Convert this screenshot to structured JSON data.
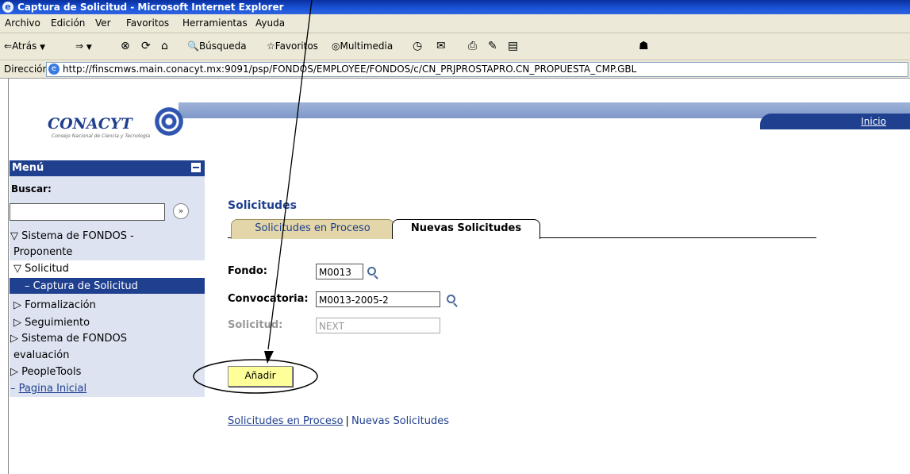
{
  "window": {
    "title": "Captura de Solicitud - Microsoft Internet Explorer"
  },
  "menubar": {
    "items": [
      "Archivo",
      "Edición",
      "Ver",
      "Favoritos",
      "Herramientas",
      "Ayuda"
    ]
  },
  "toolbar": {
    "back_label": "Atrás",
    "search_label": "Búsqueda",
    "favorites_label": "Favoritos",
    "multimedia_label": "Multimedia"
  },
  "address": {
    "label": "Dirección",
    "url": "http://finscmws.main.conacyt.mx:9091/psp/FONDOS/EMPLOYEE/FONDOS/c/CN_PRJPROSTAPRO.CN_PROPUESTA_CMP.GBL"
  },
  "header": {
    "logo_text": "CONACYT",
    "logo_tagline": "Consejo Nacional de Ciencia y Tecnología",
    "home_link": "Inicio"
  },
  "sidebar": {
    "menu_title": "Menú",
    "search_label": "Buscar:",
    "search_value": "",
    "items": [
      {
        "label": "Sistema de FONDOS -",
        "marker": "▽"
      },
      {
        "label": "Proponente",
        "marker": ""
      },
      {
        "label": "Solicitud",
        "marker": "▽"
      },
      {
        "label": "Captura de Solicitud",
        "marker": "–"
      },
      {
        "label": "Formalización",
        "marker": "▷"
      },
      {
        "label": "Seguimiento",
        "marker": "▷"
      },
      {
        "label": "Sistema de FONDOS",
        "marker": "▷"
      },
      {
        "label": "evaluación",
        "marker": ""
      },
      {
        "label": "PeopleTools",
        "marker": "▷"
      },
      {
        "label": "Pagina Inicial",
        "marker": "–"
      }
    ]
  },
  "main": {
    "title": "Solicitudes",
    "tabs": [
      {
        "label": "Solicitudes en Proceso"
      },
      {
        "label": "Nuevas Solicitudes"
      }
    ],
    "fields": {
      "fondo_label": "Fondo:",
      "fondo_value": "M0013",
      "convocatoria_label": "Convocatoria:",
      "convocatoria_value": "M0013-2005-2",
      "solicitud_label": "Solicitud:",
      "solicitud_value": "NEXT"
    },
    "add_button": "Añadir",
    "bottom_links": [
      "Solicitudes en Proceso",
      "Nuevas Solicitudes"
    ]
  }
}
